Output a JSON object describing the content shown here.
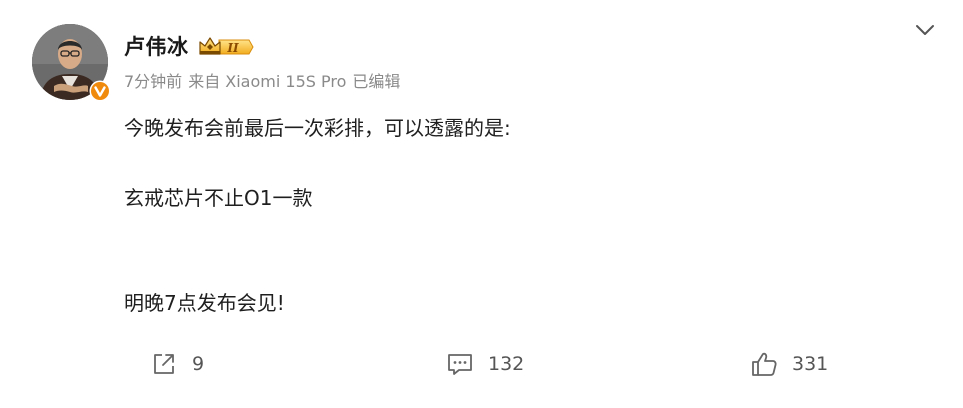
{
  "post": {
    "author": {
      "name": "卢伟冰",
      "level_badge_text": "II"
    },
    "meta": {
      "time": "7分钟前",
      "source": "来自 Xiaomi 15S Pro",
      "edited": "已编辑"
    },
    "content": {
      "lines": [
        "今晚发布会前最后一次彩排，可以透露的是:",
        "玄戒芯片不止O1一款",
        "明晚7点发布会见!"
      ]
    },
    "actions": {
      "share_count": "9",
      "comment_count": "132",
      "like_count": "331"
    }
  },
  "colors": {
    "text_primary": "#1f1f1f",
    "text_secondary": "#8a8a8a",
    "badge_gold": "#f5b82e",
    "verified_orange": "#f08a0c"
  },
  "icons": {
    "more": "chevron-down-icon",
    "share": "share-icon",
    "comment": "comment-icon",
    "like": "thumbs-up-icon",
    "verified": "verified-v-icon",
    "level": "crown-level-icon"
  }
}
